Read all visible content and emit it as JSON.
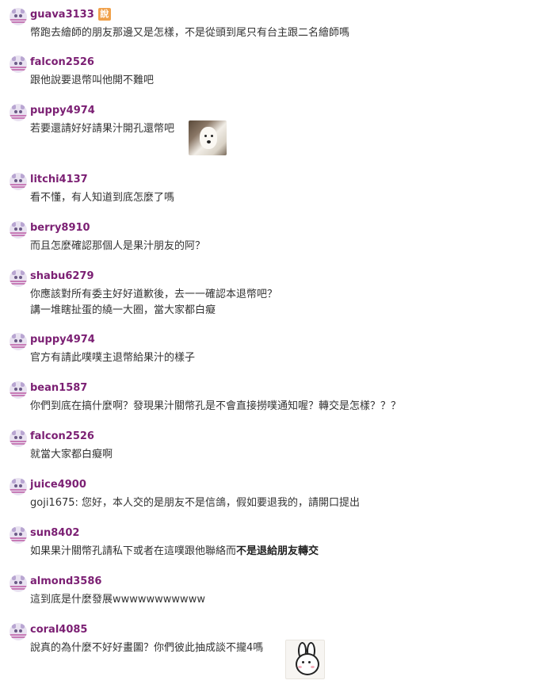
{
  "comments": [
    {
      "username": "guava3133",
      "badge": "說",
      "text": "幣跑去繪師的朋友那邊又是怎樣，不是從頭到尾只有台主跟二名繪師嗎"
    },
    {
      "username": "falcon2526",
      "text": "跟他說要退幣叫他開不難吧"
    },
    {
      "username": "puppy4974",
      "text": "若要還請好好請果汁開孔還幣吧",
      "sticker": "dog-photo"
    },
    {
      "username": "litchi4137",
      "text": "看不懂，有人知道到底怎麼了嗎"
    },
    {
      "username": "berry8910",
      "text": "而且怎麼確認那個人是果汁朋友的阿？"
    },
    {
      "username": "shabu6279",
      "text": "你應該對所有委主好好道歉後，去一一確認本退幣吧？",
      "text2": "講一堆瞎扯蛋的繞一大圈，當大家都白癡"
    },
    {
      "username": "puppy4974",
      "text": "官方有請此噗噗主退幣給果汁的樣子"
    },
    {
      "username": "bean1587",
      "text": "你們到底在搞什麼啊？發現果汁關幣孔是不會直接撈噗通知喔？轉交是怎樣？？？"
    },
    {
      "username": "falcon2526",
      "text": "就當大家都白癡啊"
    },
    {
      "username": "juice4900",
      "text": "goji1675: 您好，本人交的是朋友不是信鴿，假如要退我的，請開口提出"
    },
    {
      "username": "sun8402",
      "text": "如果果汁關幣孔請私下或者在這噗跟他聯絡而",
      "text_bold": "不是退給朋友轉交"
    },
    {
      "username": "almond3586",
      "text": "這到底是什麼發展wwwwwwwwwww"
    },
    {
      "username": "coral4085",
      "text": "說真的為什麼不好好畫圖？你們彼此抽成談不攏4嗎",
      "sticker": "bunny-sticker"
    }
  ]
}
